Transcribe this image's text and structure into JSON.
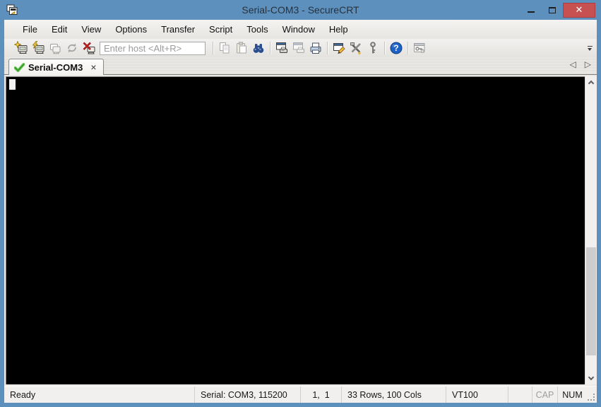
{
  "colors": {
    "titlebar_blue": "#5e90be",
    "close_button_red": "#c75050",
    "tab_check_green": "#3aa02c",
    "terminal_background": "#000000",
    "chrome_gray": "#e8e6e3"
  },
  "titlebar": {
    "title": "Serial-COM3 - SecureCRT",
    "close_glyph": "✕"
  },
  "menu": {
    "items": [
      "File",
      "Edit",
      "View",
      "Options",
      "Transfer",
      "Script",
      "Tools",
      "Window",
      "Help"
    ]
  },
  "toolbar": {
    "host_placeholder": "Enter host <Alt+R>",
    "icons": [
      "connect",
      "quick-connect",
      "connect-in-tab",
      "reconnect",
      "disconnect",
      "copy",
      "paste",
      "find",
      "print-screen",
      "print-setup",
      "print",
      "session-options",
      "global-options",
      "key-agent",
      "help",
      "secure-agent",
      "toolbar-overflow"
    ]
  },
  "tabbar": {
    "active_tab": {
      "label": "Serial-COM3",
      "close_glyph": "×",
      "status_icon": "connected-check"
    },
    "nav_left_glyph": "◁",
    "nav_right_glyph": "▷"
  },
  "statusbar": {
    "ready": "Ready",
    "serial": "Serial: COM3, 115200",
    "cursor_position": "1,  1",
    "grid_size": "33 Rows, 100 Cols",
    "emulation": "VT100",
    "caps_indicator": "CAP",
    "num_indicator": "NUM"
  }
}
